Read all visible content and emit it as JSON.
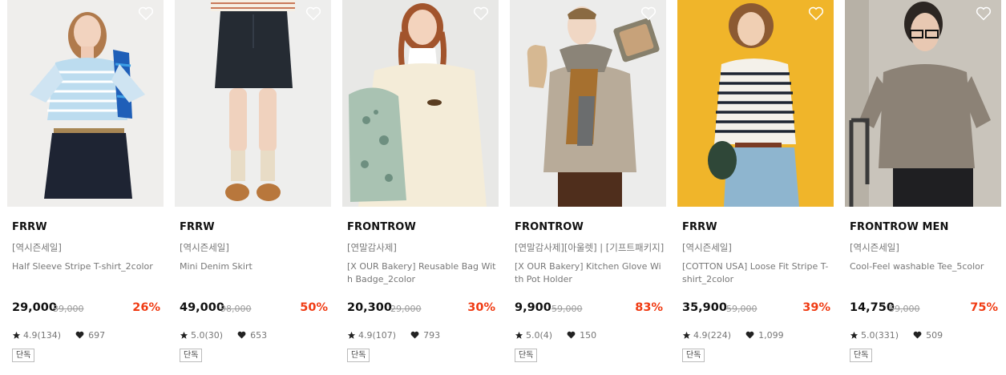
{
  "products": [
    {
      "brand": "FRRW",
      "tag": "[역시즌세일]",
      "name": "Half Sleeve Stripe T-shirt_2color",
      "price": "29,000",
      "original_price": "39,000",
      "discount": "26%",
      "rating": "4.9(134)",
      "likes": "697",
      "badge": "단독",
      "photo_bg": "#efeeec"
    },
    {
      "brand": "FRRW",
      "tag": "[역시즌세일]",
      "name": "Mini Denim Skirt",
      "price": "49,000",
      "original_price": "98,000",
      "discount": "50%",
      "rating": "5.0(30)",
      "likes": "653",
      "badge": "단독",
      "photo_bg": "#eeeeed"
    },
    {
      "brand": "FRONTROW",
      "tag": "[연말감사제]",
      "name": "[X OUR Bakery] Reusable Bag With Badge_2color",
      "price": "20,300",
      "original_price": "29,000",
      "discount": "30%",
      "rating": "4.9(107)",
      "likes": "793",
      "badge": "단독",
      "photo_bg": "#e8e8e6"
    },
    {
      "brand": "FRONTROW",
      "tag": "[연말감사제][아울렛] | [기프트패키지]",
      "name": "[X OUR Bakery] Kitchen Glove With Pot Holder",
      "price": "9,900",
      "original_price": "59,000",
      "discount": "83%",
      "rating": "5.0(4)",
      "likes": "150",
      "badge": "단독",
      "photo_bg": "#ececeb"
    },
    {
      "brand": "FRRW",
      "tag": "[역시즌세일]",
      "name": "[COTTON USA] Loose Fit Stripe T-shirt_2color",
      "price": "35,900",
      "original_price": "59,000",
      "discount": "39%",
      "rating": "4.9(224)",
      "likes": "1,099",
      "badge": "단독",
      "photo_bg": "#f0b52a"
    },
    {
      "brand": "FRONTROW MEN",
      "tag": "[역시즌세일]",
      "name": "Cool-Feel washable Tee_5color",
      "price": "14,750",
      "original_price": "59,000",
      "discount": "75%",
      "rating": "5.0(331)",
      "likes": "509",
      "badge": "단독",
      "photo_bg": "#c9c4bb"
    }
  ],
  "colors": {
    "discount": "#f03c14",
    "brand_text": "#111111",
    "muted_text": "#777777"
  },
  "icons": {
    "wishlist": "heart-outline-icon",
    "rating": "star-icon",
    "likes": "heart-filled-icon"
  }
}
